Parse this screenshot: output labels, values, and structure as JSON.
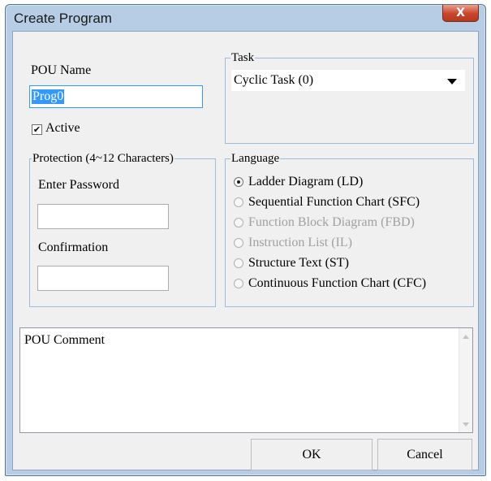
{
  "window": {
    "title": "Create Program",
    "close_glyph": "X"
  },
  "pou_name": {
    "label": "POU Name",
    "value": "Prog0"
  },
  "active": {
    "label": "Active",
    "checked": true,
    "check_glyph": "✔"
  },
  "task": {
    "group_title": "Task",
    "selected": "Cyclic Task (0)"
  },
  "protection": {
    "group_title": "Protection (4~12 Characters)",
    "password_label": "Enter Password",
    "password_value": "",
    "confirmation_label": "Confirmation",
    "confirmation_value": ""
  },
  "language": {
    "group_title": "Language",
    "options": [
      {
        "label": "Ladder Diagram (LD)",
        "checked": true,
        "enabled": true
      },
      {
        "label": "Sequential Function Chart (SFC)",
        "checked": false,
        "enabled": true
      },
      {
        "label": "Function Block Diagram (FBD)",
        "checked": false,
        "enabled": false
      },
      {
        "label": "Instruction List (IL)",
        "checked": false,
        "enabled": false
      },
      {
        "label": "Structure Text (ST)",
        "checked": false,
        "enabled": true
      },
      {
        "label": "Continuous Function Chart (CFC)",
        "checked": false,
        "enabled": true
      }
    ]
  },
  "comment": {
    "label": "POU Comment",
    "value": ""
  },
  "buttons": {
    "ok": "OK",
    "cancel": "Cancel"
  },
  "colors": {
    "frame": "#b7cde6",
    "client": "#f0f0f0",
    "close_button": "#c7452b",
    "selection": "#3399ff",
    "group_border": "#9cbcdf"
  }
}
